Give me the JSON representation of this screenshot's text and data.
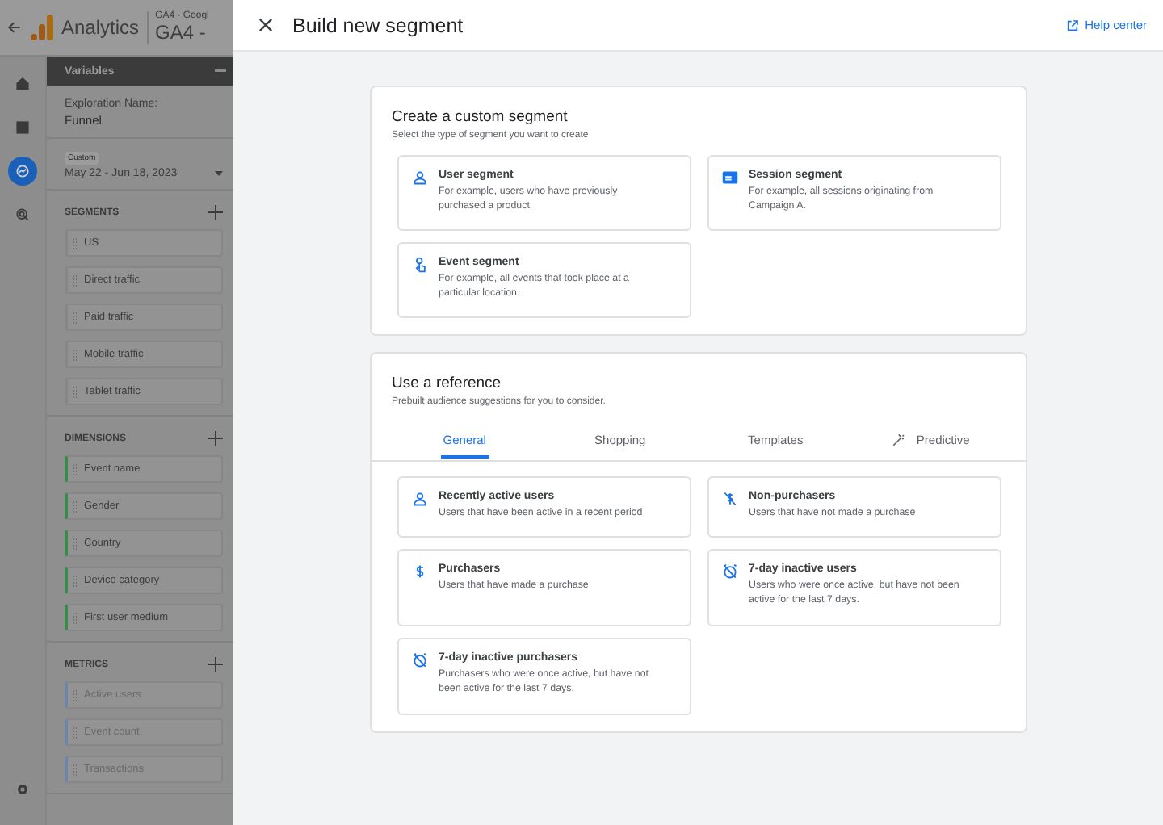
{
  "app_bar": {
    "product": "Analytics",
    "property_small": "GA4 - Googl",
    "property": "GA4 -"
  },
  "variables": {
    "title": "Variables",
    "exploration_label": "Exploration Name:",
    "exploration_name": "Funnel",
    "date_chip": "Custom",
    "date_range": "May 22 - Jun 18, 2023",
    "sections": [
      {
        "kind": "segment",
        "title": "SEGMENTS",
        "items": [
          {
            "label": "US"
          },
          {
            "label": "Direct traffic"
          },
          {
            "label": "Paid traffic"
          },
          {
            "label": "Mobile traffic"
          },
          {
            "label": "Tablet traffic"
          }
        ]
      },
      {
        "kind": "dimension",
        "title": "DIMENSIONS",
        "items": [
          {
            "label": "Event name"
          },
          {
            "label": "Gender"
          },
          {
            "label": "Country"
          },
          {
            "label": "Device category"
          },
          {
            "label": "First user medium"
          }
        ]
      },
      {
        "kind": "metric",
        "title": "METRICS",
        "items": [
          {
            "label": "Active users"
          },
          {
            "label": "Event count"
          },
          {
            "label": "Transactions"
          }
        ]
      }
    ]
  },
  "rail": [
    {
      "kind": "home",
      "selected": false
    },
    {
      "kind": "reports",
      "selected": false
    },
    {
      "kind": "explore",
      "selected": true
    },
    {
      "kind": "advertising",
      "selected": false
    }
  ],
  "drawer": {
    "title": "Build new segment",
    "help": "Help center",
    "custom": {
      "title": "Create a custom segment",
      "subtitle": "Select the type of segment you want to create",
      "options": [
        {
          "kind": "user",
          "title": "User segment",
          "description": "For example, users who have previously purchased a product."
        },
        {
          "kind": "session",
          "title": "Session segment",
          "description": "For example, all sessions originating from Campaign A."
        },
        {
          "kind": "event",
          "title": "Event segment",
          "description": "For example, all events that took place at a particular location."
        }
      ]
    },
    "reference": {
      "title": "Use a reference",
      "subtitle": "Prebuilt audience suggestions for you to consider.",
      "tabs": [
        {
          "label": "General",
          "selected": true,
          "kind": "plain"
        },
        {
          "label": "Shopping",
          "selected": false,
          "kind": "plain"
        },
        {
          "label": "Templates",
          "selected": false,
          "kind": "plain"
        },
        {
          "label": "Predictive",
          "selected": false,
          "kind": "predictive"
        }
      ],
      "options": [
        {
          "kind": "user",
          "title": "Recently active users",
          "description": "Users that have been active in a recent period"
        },
        {
          "kind": "no-purchase",
          "title": "Non-purchasers",
          "description": "Users that have not made a purchase"
        },
        {
          "kind": "purchase",
          "title": "Purchasers",
          "description": "Users that have made a purchase"
        },
        {
          "kind": "inactive",
          "title": "7-day inactive users",
          "description": "Users who were once active, but have not been active for the last 7 days."
        },
        {
          "kind": "inactive",
          "title": "7-day inactive purchasers",
          "description": "Purchasers who were once active, but have not been active for the last 7 days."
        }
      ]
    }
  }
}
